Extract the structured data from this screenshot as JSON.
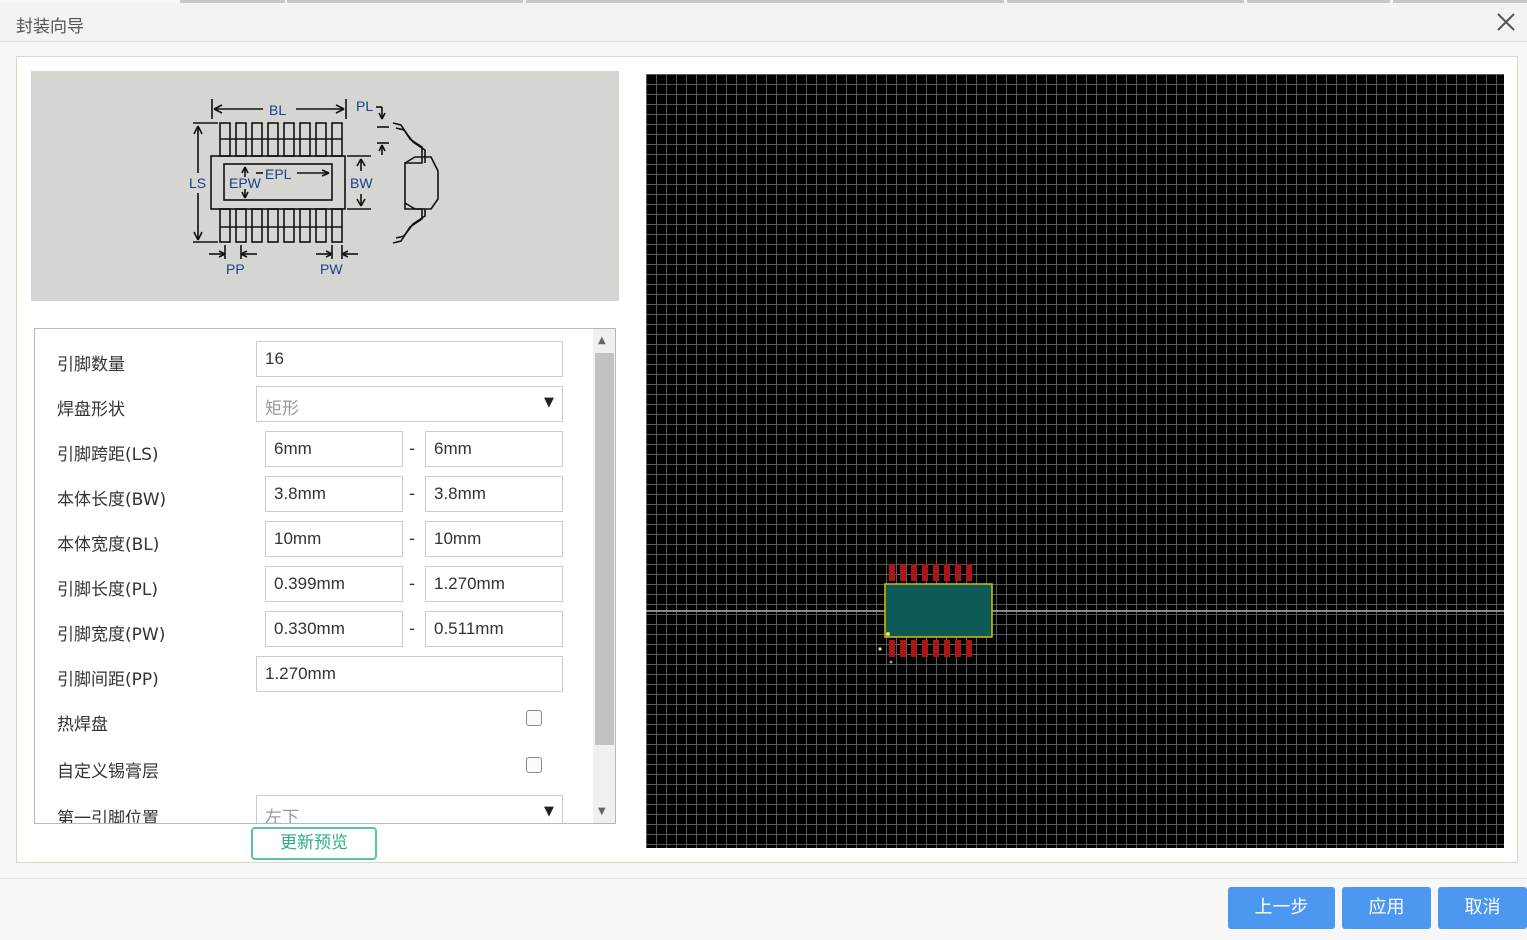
{
  "dialog": {
    "title": "封装向导"
  },
  "diagram": {
    "labels": {
      "bl": "BL",
      "pl": "PL",
      "ls": "LS",
      "epw": "EPW",
      "epl": "EPL",
      "bw": "BW",
      "pp": "PP",
      "pw": "PW"
    }
  },
  "form": {
    "pin_count": {
      "label": "引脚数量",
      "value": "16"
    },
    "pad_shape": {
      "label": "焊盘形状",
      "value": "矩形"
    },
    "ls": {
      "label": "引脚跨距(LS)",
      "min": "6mm",
      "max": "6mm"
    },
    "bw": {
      "label": "本体长度(BW)",
      "min": "3.8mm",
      "max": "3.8mm"
    },
    "bl": {
      "label": "本体宽度(BL)",
      "min": "10mm",
      "max": "10mm"
    },
    "pl": {
      "label": "引脚长度(PL)",
      "min": "0.399mm",
      "max": "1.270mm"
    },
    "pw": {
      "label": "引脚宽度(PW)",
      "min": "0.330mm",
      "max": "0.511mm"
    },
    "pp": {
      "label": "引脚间距(PP)",
      "value": "1.270mm"
    },
    "thermal_pad": {
      "label": "热焊盘"
    },
    "custom_paste": {
      "label": "自定义锡膏层"
    },
    "pin1_position": {
      "label": "第一引脚位置",
      "value": "左下"
    },
    "range_separator": "-"
  },
  "refresh_label": "更新预览",
  "footer": {
    "prev_label": "上一步",
    "apply_label": "应用",
    "cancel_label": "取消"
  },
  "colors": {
    "button": "#4c97f0",
    "refresh_border": "#57c5a8",
    "pad": "#a81818",
    "body_outline": "#d8c000",
    "body_fill": "#0e5a56"
  }
}
